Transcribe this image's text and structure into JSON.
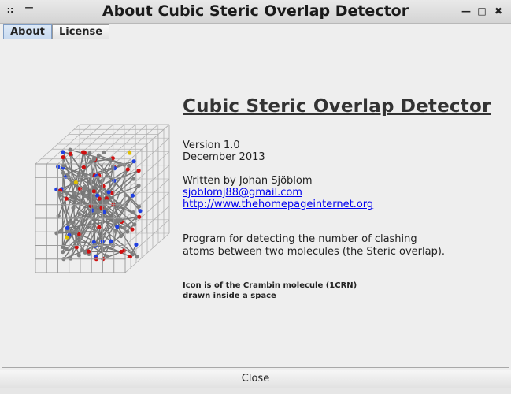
{
  "window": {
    "title": "About Cubic Steric Overlap Detector",
    "menu_glyph": "::",
    "shade_glyph": "—",
    "minimize_glyph": "—",
    "maximize_glyph": "□",
    "close_glyph": "✖"
  },
  "tabs": [
    {
      "label": "About",
      "active": true
    },
    {
      "label": "License",
      "active": false
    }
  ],
  "about": {
    "heading": "Cubic Steric Overlap Detector",
    "version": "Version 1.0",
    "date": "December 2013",
    "author": "Written by Johan Sjöblom",
    "email": "sjoblomj88@gmail.com",
    "website": "http://www.thehomepageinternet.org",
    "description_line1": "Program for detecting the number of clashing",
    "description_line2": "atoms between two molecules (the Steric overlap).",
    "icon_note_line1": "Icon is of the Crambin molecule (1CRN)",
    "icon_note_line2": "drawn inside a space"
  },
  "footer": {
    "close_label": "Close"
  },
  "colors": {
    "link": "#0000ee",
    "active_tab": "#c8daf0",
    "atom_carbon": "#808080",
    "atom_oxygen": "#d01010",
    "atom_nitrogen": "#2040e0",
    "atom_sulfur": "#e0c000"
  },
  "icon": {
    "name": "crambin-molecule-cube-icon"
  }
}
